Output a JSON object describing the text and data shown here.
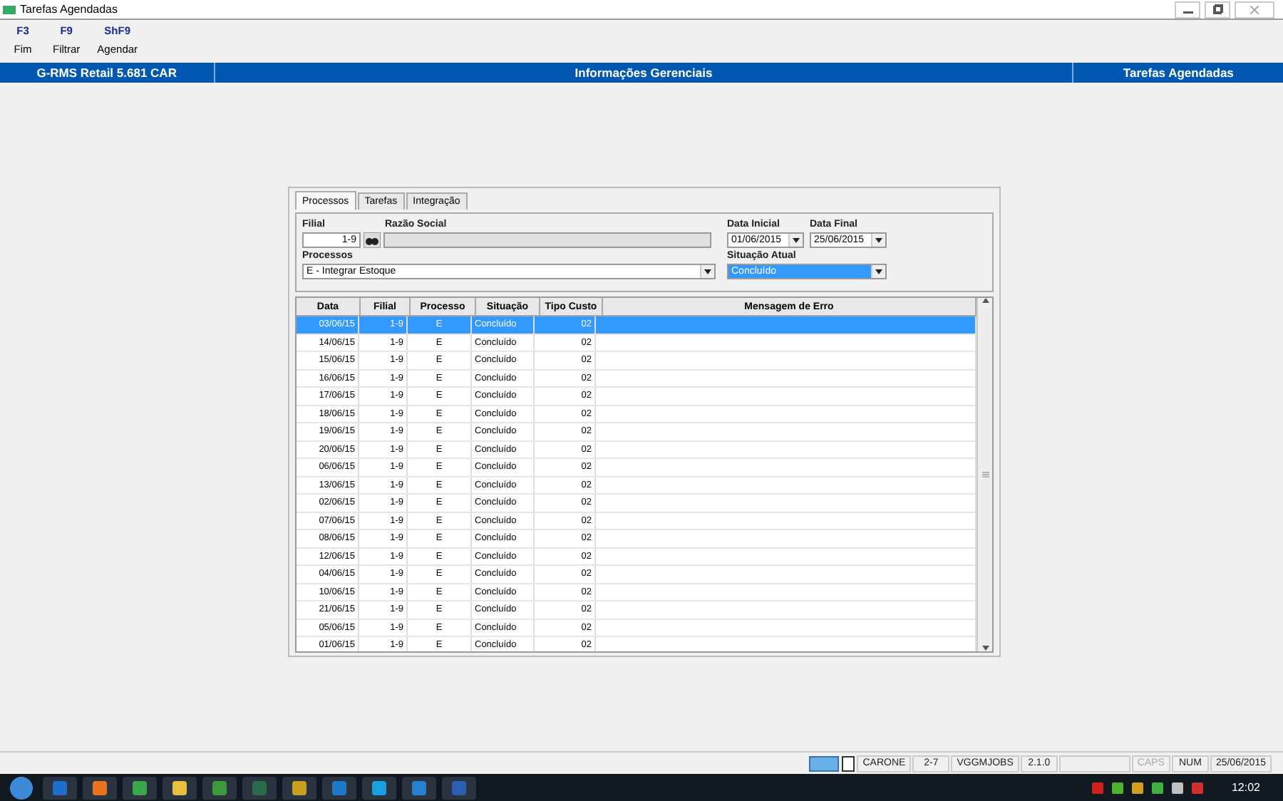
{
  "window": {
    "title": "Tarefas Agendadas"
  },
  "toolbar": [
    {
      "key": "F3",
      "label": "Fim"
    },
    {
      "key": "F9",
      "label": "Filtrar"
    },
    {
      "key": "ShF9",
      "label": "Agendar"
    }
  ],
  "header": {
    "app": "G-RMS Retail 5.681 CAR",
    "module": "Informações Gerenciais",
    "screen": "Tarefas Agendadas"
  },
  "tabs": [
    {
      "label": "Processos",
      "selected": true
    },
    {
      "label": "Tarefas",
      "selected": false
    },
    {
      "label": "Integração",
      "selected": false
    }
  ],
  "filters": {
    "filial_label": "Filial",
    "filial_value": "1-9",
    "razao_label": "Razão Social",
    "processos_label": "Processos",
    "processos_value": "E - Integrar Estoque",
    "data_inicial_label": "Data Inicial",
    "data_inicial_value": "01/06/2015",
    "data_final_label": "Data Final",
    "data_final_value": "25/06/2015",
    "situacao_label": "Situação Atual",
    "situacao_value": "Concluído"
  },
  "table": {
    "columns": [
      "Data",
      "Filial",
      "Processo",
      "Situação",
      "Tipo Custo",
      "Mensagem de Erro"
    ],
    "rows": [
      {
        "cells": [
          "03/06/15",
          "1-9",
          "E",
          "Concluído",
          "02",
          ""
        ],
        "selected": true
      },
      {
        "cells": [
          "14/06/15",
          "1-9",
          "E",
          "Concluído",
          "02",
          ""
        ],
        "selected": false
      },
      {
        "cells": [
          "15/06/15",
          "1-9",
          "E",
          "Concluído",
          "02",
          ""
        ],
        "selected": false
      },
      {
        "cells": [
          "16/06/15",
          "1-9",
          "E",
          "Concluído",
          "02",
          ""
        ],
        "selected": false
      },
      {
        "cells": [
          "17/06/15",
          "1-9",
          "E",
          "Concluído",
          "02",
          ""
        ],
        "selected": false
      },
      {
        "cells": [
          "18/06/15",
          "1-9",
          "E",
          "Concluído",
          "02",
          ""
        ],
        "selected": false
      },
      {
        "cells": [
          "19/06/15",
          "1-9",
          "E",
          "Concluído",
          "02",
          ""
        ],
        "selected": false
      },
      {
        "cells": [
          "20/06/15",
          "1-9",
          "E",
          "Concluído",
          "02",
          ""
        ],
        "selected": false
      },
      {
        "cells": [
          "06/06/15",
          "1-9",
          "E",
          "Concluído",
          "02",
          ""
        ],
        "selected": false
      },
      {
        "cells": [
          "13/06/15",
          "1-9",
          "E",
          "Concluído",
          "02",
          ""
        ],
        "selected": false
      },
      {
        "cells": [
          "02/06/15",
          "1-9",
          "E",
          "Concluído",
          "02",
          ""
        ],
        "selected": false
      },
      {
        "cells": [
          "07/06/15",
          "1-9",
          "E",
          "Concluído",
          "02",
          ""
        ],
        "selected": false
      },
      {
        "cells": [
          "08/06/15",
          "1-9",
          "E",
          "Concluído",
          "02",
          ""
        ],
        "selected": false
      },
      {
        "cells": [
          "12/06/15",
          "1-9",
          "E",
          "Concluído",
          "02",
          ""
        ],
        "selected": false
      },
      {
        "cells": [
          "04/06/15",
          "1-9",
          "E",
          "Concluído",
          "02",
          ""
        ],
        "selected": false
      },
      {
        "cells": [
          "10/06/15",
          "1-9",
          "E",
          "Concluído",
          "02",
          ""
        ],
        "selected": false
      },
      {
        "cells": [
          "21/06/15",
          "1-9",
          "E",
          "Concluído",
          "02",
          ""
        ],
        "selected": false
      },
      {
        "cells": [
          "05/06/15",
          "1-9",
          "E",
          "Concluído",
          "02",
          ""
        ],
        "selected": false
      },
      {
        "cells": [
          "01/06/15",
          "1-9",
          "E",
          "Concluído",
          "02",
          ""
        ],
        "selected": false
      }
    ]
  },
  "status_bar": [
    {
      "kind": "icon"
    },
    {
      "kind": "icon"
    },
    {
      "kind": "text",
      "text": "CARONE",
      "on": true
    },
    {
      "kind": "text",
      "text": "2-7",
      "on": true
    },
    {
      "kind": "text",
      "text": "VGGMJOBS",
      "on": true
    },
    {
      "kind": "text",
      "text": "2.1.0",
      "on": true
    },
    {
      "kind": "blank"
    },
    {
      "kind": "text",
      "text": "CAPS",
      "on": false
    },
    {
      "kind": "text",
      "text": "NUM",
      "on": true
    },
    {
      "kind": "text",
      "text": "25/06/2015",
      "on": true
    }
  ],
  "taskbar": {
    "clock": "12:02",
    "apps": [
      {
        "color": "#1e6fc8"
      },
      {
        "color": "#e8731c"
      },
      {
        "color": "#3aa84a"
      },
      {
        "color": "#e8c040"
      },
      {
        "color": "#3c9a3c"
      },
      {
        "color": "#2a6a4a"
      },
      {
        "color": "#c8a020"
      },
      {
        "color": "#1f78c8"
      },
      {
        "color": "#1aa0e0"
      },
      {
        "color": "#2a80d0"
      },
      {
        "color": "#2b5fb0"
      }
    ],
    "tray": [
      {
        "color": "#d02020"
      },
      {
        "color": "#50b030"
      },
      {
        "color": "#d0a020"
      },
      {
        "color": "#40b040"
      },
      {
        "color": "#c0c0c0"
      },
      {
        "color": "#d03030"
      }
    ]
  }
}
